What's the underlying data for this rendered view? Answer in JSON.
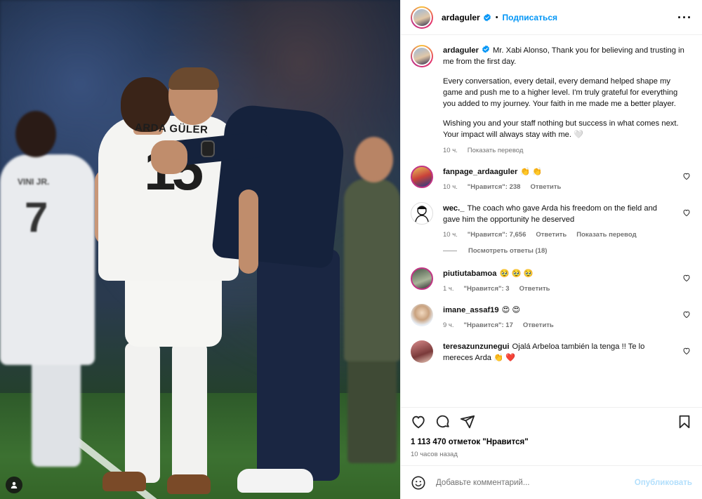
{
  "post": {
    "username": "ardaguler",
    "follow_label": "Подписаться",
    "dot": "•",
    "more_label": "···"
  },
  "photo": {
    "shirt_name": "ARDA GÜLER",
    "shirt_number": "15",
    "left_shirt_name": "VINI JR.",
    "left_shirt_number": "7"
  },
  "caption": {
    "username": "ardaguler",
    "paragraphs": [
      "Mr. Xabi Alonso, Thank you for believing and trusting in me from the first day.",
      "Every conversation, every detail, every demand helped shape my game and push me to a higher level. I'm truly grateful for everything you added to my journey. Your faith in me made me a better player.",
      "Wishing you and your staff nothing but success in what comes next. Your impact will always stay with me. 🤍"
    ],
    "time": "10 ч.",
    "translate_label": "Показать перевод"
  },
  "comments": [
    {
      "username": "fanpage_ardaaguler",
      "text": "👏 👏",
      "time": "10 ч.",
      "likes": "\"Нравится\": 238",
      "reply_label": "Ответить",
      "translate_label": ""
    },
    {
      "username": "wec._",
      "text": "The coach who gave Arda his freedom on the field and gave him the opportunity he deserved",
      "time": "10 ч.",
      "likes": "\"Нравится\": 7,656",
      "reply_label": "Ответить",
      "translate_label": "Показать перевод",
      "view_replies": "Посмотреть ответы (18)"
    },
    {
      "username": "piutiutabamoa",
      "text": "🥹 🥹 🥹",
      "time": "1 ч.",
      "likes": "\"Нравится\": 3",
      "reply_label": "Ответить",
      "translate_label": ""
    },
    {
      "username": "imane_assaf19",
      "text": "😍 😍",
      "time": "9 ч.",
      "likes": "\"Нравится\": 17",
      "reply_label": "Ответить",
      "translate_label": ""
    },
    {
      "username": "teresazunzunegui",
      "text": "Ojalá Arbeloa también la tenga !! Te lo mereces Arda 👏 ❤️",
      "time": "",
      "likes": "",
      "reply_label": "",
      "translate_label": ""
    }
  ],
  "stats": {
    "likes": "1 113 470 отметок \"Нравится\"",
    "time_ago": "10 часов назад"
  },
  "compose": {
    "placeholder": "Добавьте комментарий...",
    "post_label": "Опубликовать"
  },
  "colors": {
    "accent": "#0095f6",
    "post_disabled": "#b2dffc",
    "verified": "#0095f6",
    "muted": "#737373"
  },
  "icons": [
    "verified-badge-icon",
    "more-icon",
    "heart-icon",
    "comment-icon",
    "share-icon",
    "bookmark-icon",
    "emoji-icon",
    "user-tag-icon"
  ]
}
